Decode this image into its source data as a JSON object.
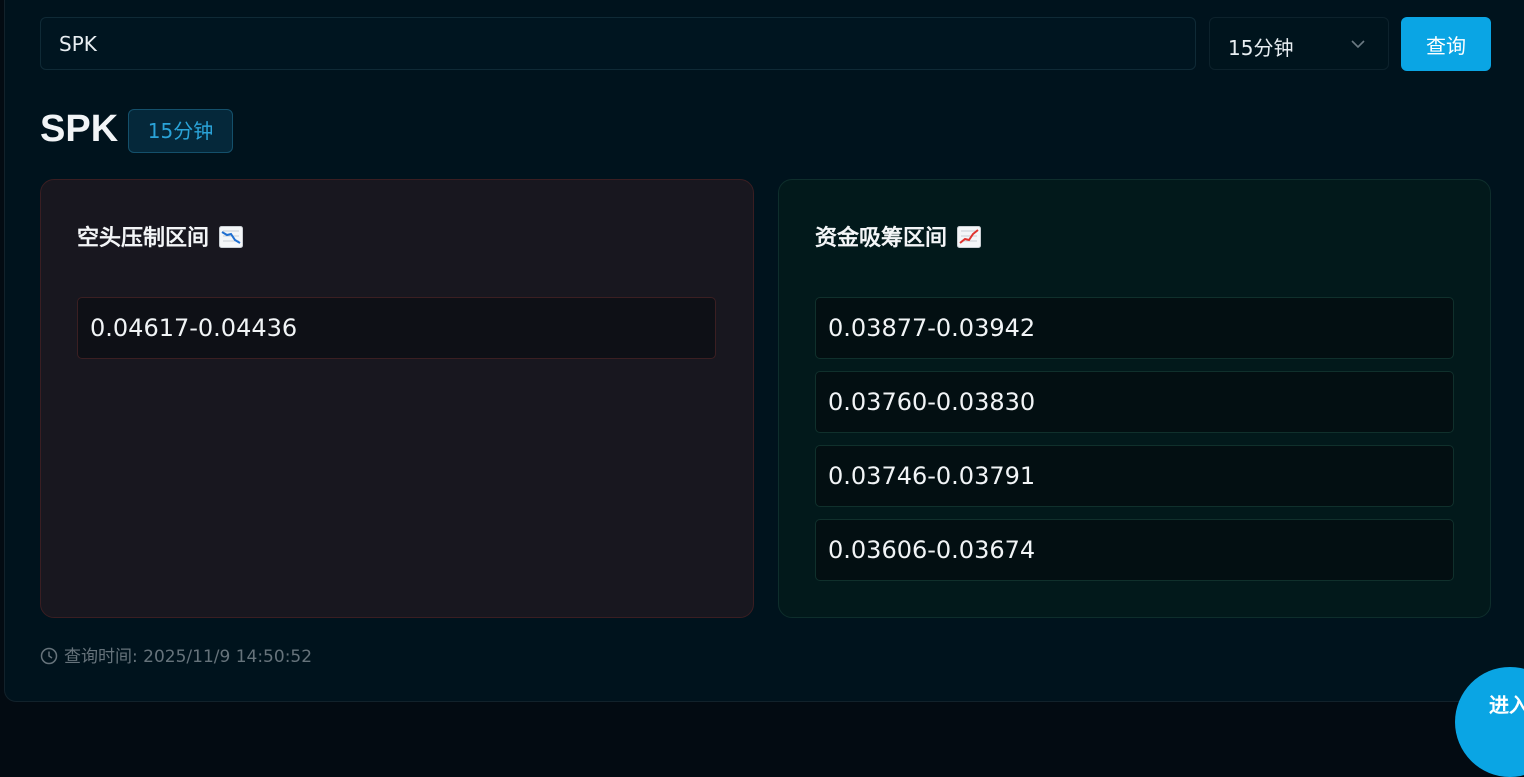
{
  "search": {
    "value": "SPK"
  },
  "interval_select": {
    "selected": "15分钟",
    "icon": "chevron-down-icon"
  },
  "query_button": {
    "label": "查询",
    "color": "#0aa5e4"
  },
  "result": {
    "symbol": "SPK",
    "interval_badge": "15分钟"
  },
  "short_zone": {
    "title": "空头压制区间",
    "icon": "chart-decreasing-icon",
    "items": [
      "0.04617-0.04436"
    ],
    "accent_color": "#3a1e22"
  },
  "long_zone": {
    "title": "资金吸筹区间",
    "icon": "chart-increasing-icon",
    "items": [
      "0.03877-0.03942",
      "0.03760-0.03830",
      "0.03746-0.03791",
      "0.03606-0.03674"
    ],
    "accent_color": "#0e2e2c"
  },
  "footer": {
    "query_time": "查询时间: 2025/11/9 14:50:52",
    "icon": "clock-icon"
  },
  "fab": {
    "label": "进入"
  }
}
